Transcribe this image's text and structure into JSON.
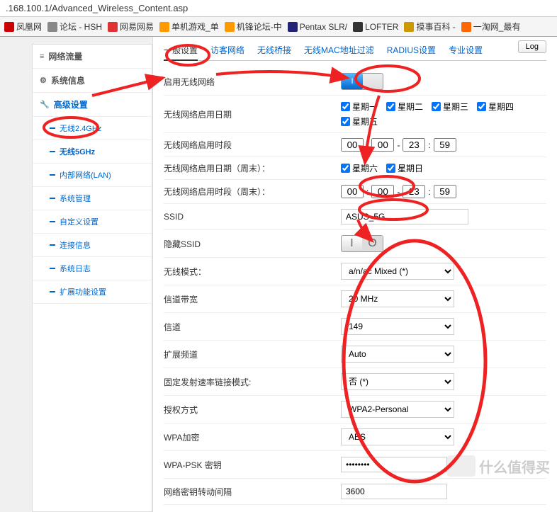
{
  "url": ".168.100.1/Advanced_Wireless_Content.asp",
  "bookmarks": [
    {
      "label": "凤凰网",
      "color": "#cc0000"
    },
    {
      "label": "论坛 - HSH",
      "color": "#888"
    },
    {
      "label": "网易网易",
      "color": "#d33"
    },
    {
      "label": "单机游戏_单",
      "color": "#f90"
    },
    {
      "label": "机锋论坛-中",
      "color": "#f90"
    },
    {
      "label": "Pentax SLR/",
      "color": "#227"
    },
    {
      "label": "LOFTER",
      "color": "#333"
    },
    {
      "label": "摸事百科 -",
      "color": "#c90"
    },
    {
      "label": "一淘网_最有",
      "color": "#f60"
    }
  ],
  "sidebar": {
    "sections": [
      {
        "icon": "≡",
        "label": "网络流量"
      },
      {
        "icon": "⚙",
        "label": "系统信息"
      },
      {
        "icon": "🔧",
        "label": "高级设置",
        "active": true
      }
    ],
    "subs": [
      {
        "label": "无线2.4GHz"
      },
      {
        "label": "无线5GHz",
        "active": true
      },
      {
        "label": "内部网络(LAN)"
      },
      {
        "label": "系统管理"
      },
      {
        "label": "自定义设置"
      },
      {
        "label": "连接信息"
      },
      {
        "label": "系统日志"
      },
      {
        "label": "扩展功能设置"
      }
    ]
  },
  "tabs": {
    "items": [
      "一般设置",
      "访客网络",
      "无线桥接",
      "无线MAC地址过滤",
      "RADIUS设置",
      "专业设置"
    ],
    "active": 0,
    "log": "Log"
  },
  "form": {
    "enable_wireless": "启用无线网络",
    "enable_days": "无线网络启用日期",
    "days": [
      "星期一",
      "星期二",
      "星期三",
      "星期四",
      "星期五"
    ],
    "enable_time": "无线网络启用时段",
    "time1": [
      "00",
      "00",
      "23",
      "59"
    ],
    "enable_days_weekend": "无线网络启用日期（周末）：",
    "weekend_days": [
      "星期六",
      "星期日"
    ],
    "enable_time_weekend": "无线网络启用时段（周末）：",
    "time2": [
      "00",
      "00",
      "23",
      "59"
    ],
    "ssid_label": "SSID",
    "ssid_value": "ASUS_5G",
    "hide_ssid": "隐藏SSID",
    "mode_label": "无线模式：",
    "mode_value": "a/n/ac Mixed (*)",
    "bandwidth_label": "信道带宽",
    "bandwidth_value": "20 MHz",
    "channel_label": "信道",
    "channel_value": "149",
    "ext_channel_label": "扩展频道",
    "ext_channel_value": "Auto",
    "fixed_rate_label": "固定发射速率链接模式:",
    "fixed_rate_value": "否 (*)",
    "auth_label": "授权方式",
    "auth_value": "WPA2-Personal",
    "wpa_enc_label": "WPA加密",
    "wpa_enc_value": "AES",
    "wpa_psk_label": "WPA-PSK 密钥",
    "wpa_psk_value": "••••••••",
    "rekey_label": "网络密钥转动间隔",
    "rekey_value": "3600"
  },
  "watermark": "什么值得买"
}
